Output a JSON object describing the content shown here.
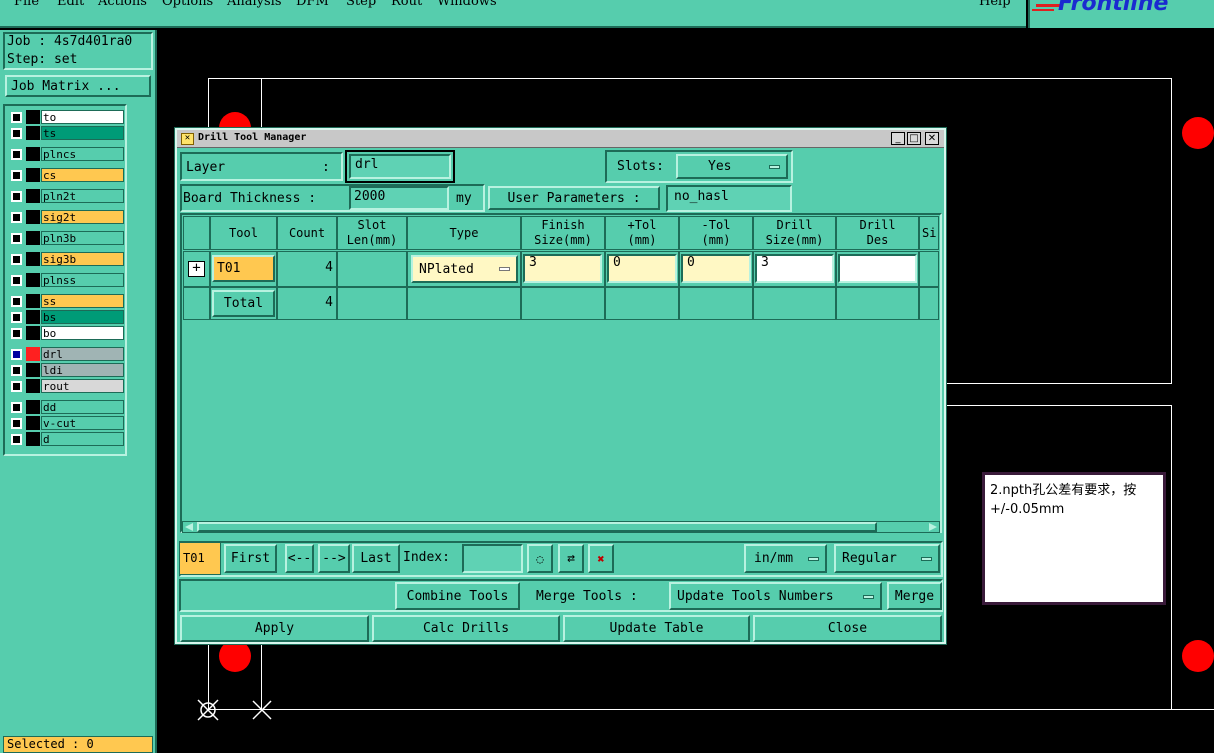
{
  "menu": [
    "File",
    "Edit",
    "Actions",
    "Options",
    "Analysis",
    "DFM",
    "Step",
    "Rout",
    "Windows"
  ],
  "help": "Help",
  "logo": "Frontline",
  "job_label": "Job : 4s7d401ra0",
  "step_label": "Step: set",
  "job_matrix": "Job Matrix ...",
  "layers": [
    {
      "name": "to",
      "color": "#ffffff"
    },
    {
      "name": "ts",
      "color": "#009b77"
    },
    {
      "name": "plncs",
      "color": "#56cdad"
    },
    {
      "name": "cs",
      "color": "#ffc850"
    },
    {
      "name": "pln2t",
      "color": "#56cdad"
    },
    {
      "name": "sig2t",
      "color": "#ffc850"
    },
    {
      "name": "pln3b",
      "color": "#56cdad"
    },
    {
      "name": "sig3b",
      "color": "#ffc850"
    },
    {
      "name": "plnss",
      "color": "#56cdad"
    },
    {
      "name": "ss",
      "color": "#ffc850"
    },
    {
      "name": "bs",
      "color": "#009b77"
    },
    {
      "name": "bo",
      "color": "#ffffff"
    },
    {
      "name": "drl",
      "color": "#a0b4b4"
    },
    {
      "name": "ldi",
      "color": "#a0b4b4"
    },
    {
      "name": "rout",
      "color": "#d8d8d8"
    },
    {
      "name": "dd",
      "color": "#56cdad"
    },
    {
      "name": "v-cut",
      "color": "#56cdad"
    },
    {
      "name": "d",
      "color": "#56cdad"
    }
  ],
  "selected": "Selected : 0",
  "dialog": {
    "title": "Drill Tool Manager",
    "layer_label": "Layer",
    "layer_colon": ":",
    "layer_value": "drl",
    "slots_label": "Slots:",
    "slots_value": "Yes",
    "board_thickness_label": "Board Thickness :",
    "board_thickness_value": "2000",
    "unit": "my",
    "user_params_label": "User Parameters :",
    "user_params_value": "no_hasl",
    "headers": {
      "tool": "Tool",
      "count": "Count",
      "slot_len": "Slot Len(mm)",
      "type": "Type",
      "finish_size": "Finish Size(mm)",
      "ptol": "+Tol (mm)",
      "mtol": "-Tol (mm)",
      "drill_size": "Drill Size(mm)",
      "drill_des": "Drill Des",
      "si": "Si"
    },
    "rows": [
      {
        "tool": "T01",
        "count": "4",
        "type": "NPlated",
        "finish": "3",
        "ptol": "0",
        "mtol": "0",
        "drill": "3",
        "des": ""
      }
    ],
    "total_label": "Total",
    "total_count": "4",
    "current_tool": "T01",
    "first": "First",
    "prev": "<--",
    "next": "-->",
    "last": "Last",
    "index_label": "Index:",
    "units_select": "in/mm",
    "mode_select": "Regular",
    "combine_tools": "Combine Tools",
    "merge_tools_label": "Merge Tools :",
    "update_numbers": "Update Tools Numbers",
    "merge": "Merge",
    "apply": "Apply",
    "calc_drills": "Calc Drills",
    "update_table": "Update Table",
    "close": "Close"
  },
  "note": "2.npth孔公差有要求，按+/-0.05mm"
}
